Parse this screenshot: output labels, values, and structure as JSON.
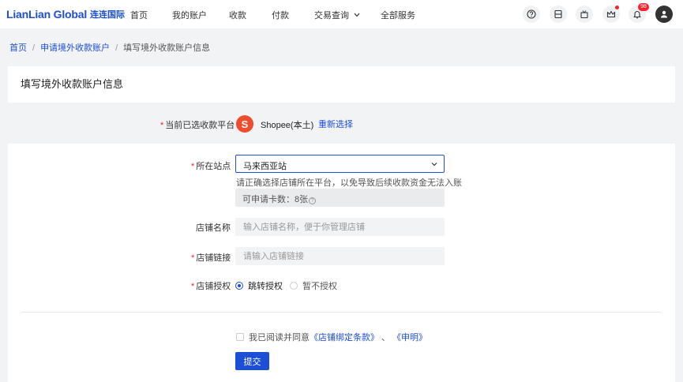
{
  "brand": {
    "name_en": "LianLian Global",
    "name_cn": "连连国际"
  },
  "nav": {
    "home": "首页",
    "my_account": "我的账户",
    "receive": "收款",
    "pay": "付款",
    "transactions": "交易查询",
    "all_services": "全部服务"
  },
  "header_icons": [
    "help-icon",
    "wallet-icon",
    "gift-icon",
    "crown-icon",
    "bell-icon",
    "user-icon"
  ],
  "notifications": {
    "count": "98"
  },
  "breadcrumb": {
    "home": "首页",
    "apply": "申请境外收款账户",
    "current": "填写境外收款账户信息",
    "separator": "/"
  },
  "page_title": "填写境外收款账户信息",
  "form": {
    "platform": {
      "label": "当前已选收款平台",
      "logo_letter": "S",
      "name": "Shopee(本土)",
      "reselect": "重新选择"
    },
    "site": {
      "label": "所在站点",
      "value": "马来西亚站",
      "hint": "请正确选择店铺所在平台，以免导致后续收款资金无法入账",
      "quota_text": "可申请卡数：8张",
      "quota_icon": "?"
    },
    "store_name": {
      "label": "店铺名称",
      "placeholder": "输入店铺名称，便于你管理店铺"
    },
    "store_link": {
      "label": "店铺链接",
      "placeholder": "请输入店铺链接"
    },
    "auth": {
      "label": "店铺授权",
      "options": [
        "跳转授权",
        "暂不授权"
      ],
      "selected": "跳转授权"
    },
    "agreement": {
      "text": "我已阅读并同意",
      "link1": "《店铺绑定条款》",
      "separator": "、",
      "link2": "《申明》"
    },
    "submit": "提交"
  },
  "required_mark": "*",
  "colors": {
    "primary": "#1d4fd6",
    "shopee": "#ee4d2d",
    "danger": "#f5222d"
  }
}
